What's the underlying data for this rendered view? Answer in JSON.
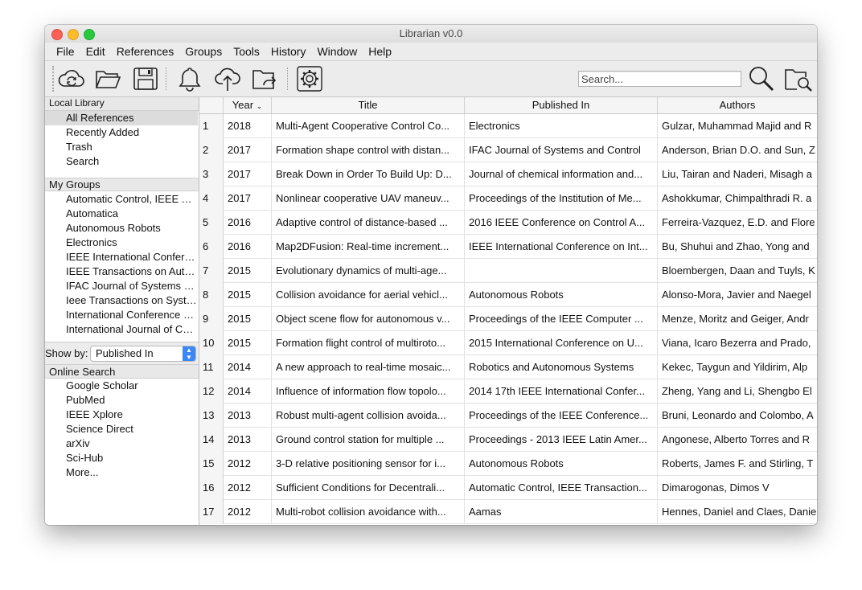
{
  "window": {
    "title": "Librarian v0.0"
  },
  "menu": [
    "File",
    "Edit",
    "References",
    "Groups",
    "Tools",
    "History",
    "Window",
    "Help"
  ],
  "toolbar": {
    "icons": [
      "sync-icon",
      "open-folder-icon",
      "save-icon",
      "bell-icon",
      "cloud-upload-icon",
      "export-folder-icon",
      "settings-gear-icon",
      "search-icon",
      "folder-search-icon"
    ],
    "search_placeholder": "Search..."
  },
  "sidebar": {
    "local_library": {
      "header": "Local Library",
      "items": [
        "All References",
        "Recently Added",
        "Trash",
        "Search"
      ],
      "selected": "All References"
    },
    "my_groups": {
      "header": "My Groups",
      "items": [
        "Automatic Control, IEEE Transactions on",
        "Automatica",
        "Autonomous Robots",
        "Electronics",
        "IEEE International Conference on Robotics",
        "IEEE Transactions on Automatic Control",
        "IFAC Journal of Systems and Control",
        "Ieee Transactions on Systems",
        "International Conference on Unmanned",
        "International Journal of Control"
      ]
    },
    "show_by": {
      "label": "Show by:",
      "value": "Published In"
    },
    "online_search": {
      "header": "Online Search",
      "items": [
        "Google Scholar",
        "PubMed",
        "IEEE Xplore",
        "Science Direct",
        "arXiv",
        "Sci-Hub",
        "More..."
      ]
    }
  },
  "table": {
    "columns": [
      "Year",
      "Title",
      "Published In",
      "Authors"
    ],
    "sort_indicator": "chevron-down-icon",
    "rows": [
      {
        "n": "1",
        "year": "2018",
        "title": "Multi-Agent Cooperative Control Co...",
        "pub": "Electronics",
        "authors": "Gulzar, Muhammad Majid and R"
      },
      {
        "n": "2",
        "year": "2017",
        "title": "Formation shape control with distan...",
        "pub": "IFAC Journal of Systems and Control",
        "authors": "Anderson, Brian D.O. and Sun, Z"
      },
      {
        "n": "3",
        "year": "2017",
        "title": "Break Down in Order To Build Up: D...",
        "pub": "Journal of chemical information and...",
        "authors": "Liu, Tairan and Naderi, Misagh a"
      },
      {
        "n": "4",
        "year": "2017",
        "title": "Nonlinear cooperative UAV maneuv...",
        "pub": "Proceedings of the Institution of Me...",
        "authors": "Ashokkumar, Chimpalthradi R. a"
      },
      {
        "n": "5",
        "year": "2016",
        "title": "Adaptive control of distance-based ...",
        "pub": "2016 IEEE Conference on Control A...",
        "authors": "Ferreira-Vazquez, E.D. and Flore"
      },
      {
        "n": "6",
        "year": "2016",
        "title": "Map2DFusion: Real-time increment...",
        "pub": "IEEE International Conference on Int...",
        "authors": "Bu, Shuhui and Zhao, Yong and"
      },
      {
        "n": "7",
        "year": "2015",
        "title": "Evolutionary dynamics of multi-age...",
        "pub": "",
        "authors": "Bloembergen, Daan and Tuyls, K"
      },
      {
        "n": "8",
        "year": "2015",
        "title": "Collision avoidance for aerial vehicl...",
        "pub": "Autonomous Robots",
        "authors": "Alonso-Mora, Javier and Naegel"
      },
      {
        "n": "9",
        "year": "2015",
        "title": "Object scene flow for autonomous v...",
        "pub": "Proceedings of the IEEE Computer ...",
        "authors": "Menze, Moritz and Geiger, Andr"
      },
      {
        "n": "10",
        "year": "2015",
        "title": "Formation flight control of multiroto...",
        "pub": "2015 International Conference on U...",
        "authors": "Viana, Icaro Bezerra and Prado,"
      },
      {
        "n": "11",
        "year": "2014",
        "title": "A new approach to real-time mosaic...",
        "pub": "Robotics and Autonomous Systems",
        "authors": "Kekec, Taygun and Yildirim, Alp"
      },
      {
        "n": "12",
        "year": "2014",
        "title": "Influence of information flow topolo...",
        "pub": "2014 17th IEEE International Confer...",
        "authors": "Zheng, Yang and Li, Shengbo El"
      },
      {
        "n": "13",
        "year": "2013",
        "title": "Robust multi-agent collision avoida...",
        "pub": "Proceedings of the IEEE Conference...",
        "authors": "Bruni, Leonardo and Colombo, A"
      },
      {
        "n": "14",
        "year": "2013",
        "title": "Ground control station for multiple ...",
        "pub": "Proceedings - 2013 IEEE Latin Amer...",
        "authors": "Angonese, Alberto Torres and R"
      },
      {
        "n": "15",
        "year": "2012",
        "title": "3-D relative positioning sensor for i...",
        "pub": "Autonomous Robots",
        "authors": "Roberts, James F. and Stirling, T"
      },
      {
        "n": "16",
        "year": "2012",
        "title": "Sufficient Conditions for Decentrali...",
        "pub": "Automatic Control, IEEE Transaction...",
        "authors": "Dimarogonas, Dimos V"
      },
      {
        "n": "17",
        "year": "2012",
        "title": "Multi-robot collision avoidance with...",
        "pub": "Aamas",
        "authors": "Hennes, Daniel and Claes, Danie"
      }
    ]
  }
}
